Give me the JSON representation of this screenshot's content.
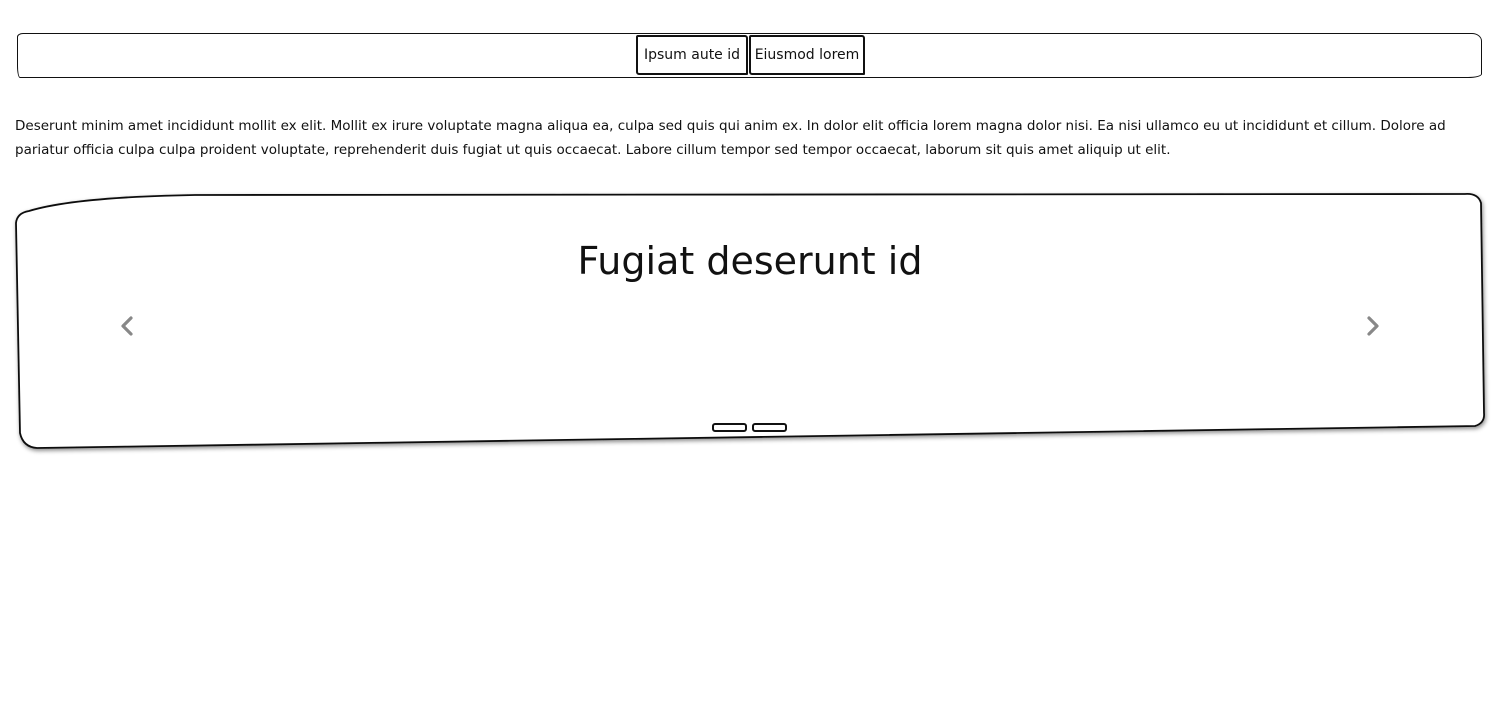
{
  "navbar": {
    "buttons": [
      {
        "label": "Ipsum aute id"
      },
      {
        "label": "Eiusmod lorem"
      }
    ]
  },
  "intro": {
    "text": "Deserunt minim amet incididunt mollit ex elit. Mollit ex irure voluptate magna aliqua ea, culpa sed quis qui anim ex. In dolor elit officia lorem magna dolor nisi. Ea nisi ullamco eu ut incididunt et cillum. Dolore ad pariatur officia culpa culpa proident voluptate, reprehenderit duis fugiat ut quis occaecat. Labore cillum tempor sed tempor occaecat, laborum sit quis amet aliquip ut elit."
  },
  "carousel": {
    "slide_title": "Fugiat deserunt id",
    "prev_icon": "chevron-left-icon",
    "next_icon": "chevron-right-icon",
    "indicator_count": 2,
    "arrow_color": "#888888"
  }
}
